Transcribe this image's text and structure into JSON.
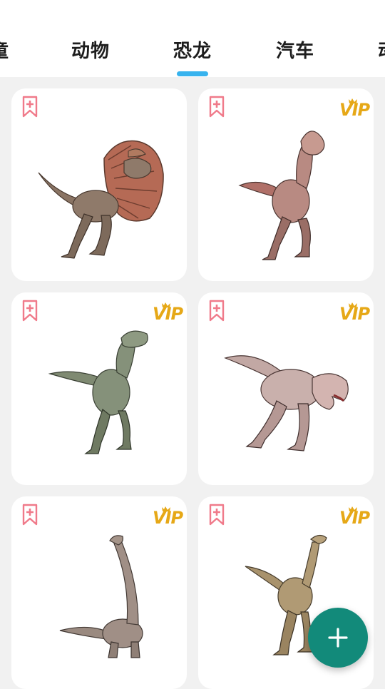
{
  "tabs": [
    {
      "label": "童"
    },
    {
      "label": "动物"
    },
    {
      "label": "恐龙"
    },
    {
      "label": "汽车"
    },
    {
      "label": "动"
    }
  ],
  "selected_tab": "恐龙",
  "colors": {
    "accent": "#37b3ee",
    "bookmark": "#f07a8a",
    "vip": "#e6a817",
    "fab": "#128a7a"
  },
  "cards": [
    {
      "dino": "dilophosaurus",
      "vip": false,
      "vip_label": ""
    },
    {
      "dino": "theropod-crested",
      "vip": true,
      "vip_label": "VIP"
    },
    {
      "dino": "velociraptor",
      "vip": true,
      "vip_label": "VIP"
    },
    {
      "dino": "carnotaurus",
      "vip": true,
      "vip_label": "VIP"
    },
    {
      "dino": "brachiosaurus",
      "vip": true,
      "vip_label": "VIP"
    },
    {
      "dino": "ornithomimus",
      "vip": true,
      "vip_label": "VIP"
    }
  ],
  "fab": {
    "icon": "plus-icon"
  }
}
